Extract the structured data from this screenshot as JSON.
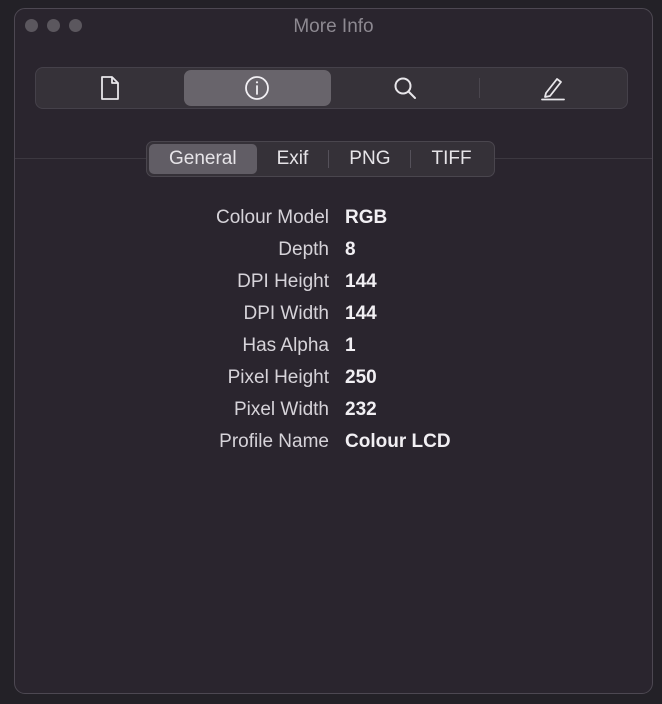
{
  "window": {
    "title": "More Info"
  },
  "toolbar": {
    "items": [
      {
        "icon": "document-icon"
      },
      {
        "icon": "info-icon",
        "active": true
      },
      {
        "icon": "search-icon"
      },
      {
        "icon": "pencil-icon"
      }
    ]
  },
  "tabs": [
    {
      "label": "General",
      "active": true
    },
    {
      "label": "Exif"
    },
    {
      "label": "PNG"
    },
    {
      "label": "TIFF"
    }
  ],
  "properties": [
    {
      "label": "Colour Model",
      "value": "RGB"
    },
    {
      "label": "Depth",
      "value": "8"
    },
    {
      "label": "DPI Height",
      "value": "144"
    },
    {
      "label": "DPI Width",
      "value": "144"
    },
    {
      "label": "Has Alpha",
      "value": "1"
    },
    {
      "label": "Pixel Height",
      "value": "250"
    },
    {
      "label": "Pixel Width",
      "value": "232"
    },
    {
      "label": "Profile Name",
      "value": "Colour LCD"
    }
  ],
  "colors": {
    "window_bg": "#2a252e",
    "active_tool": "#68646b",
    "text": "#e6e4e8"
  }
}
